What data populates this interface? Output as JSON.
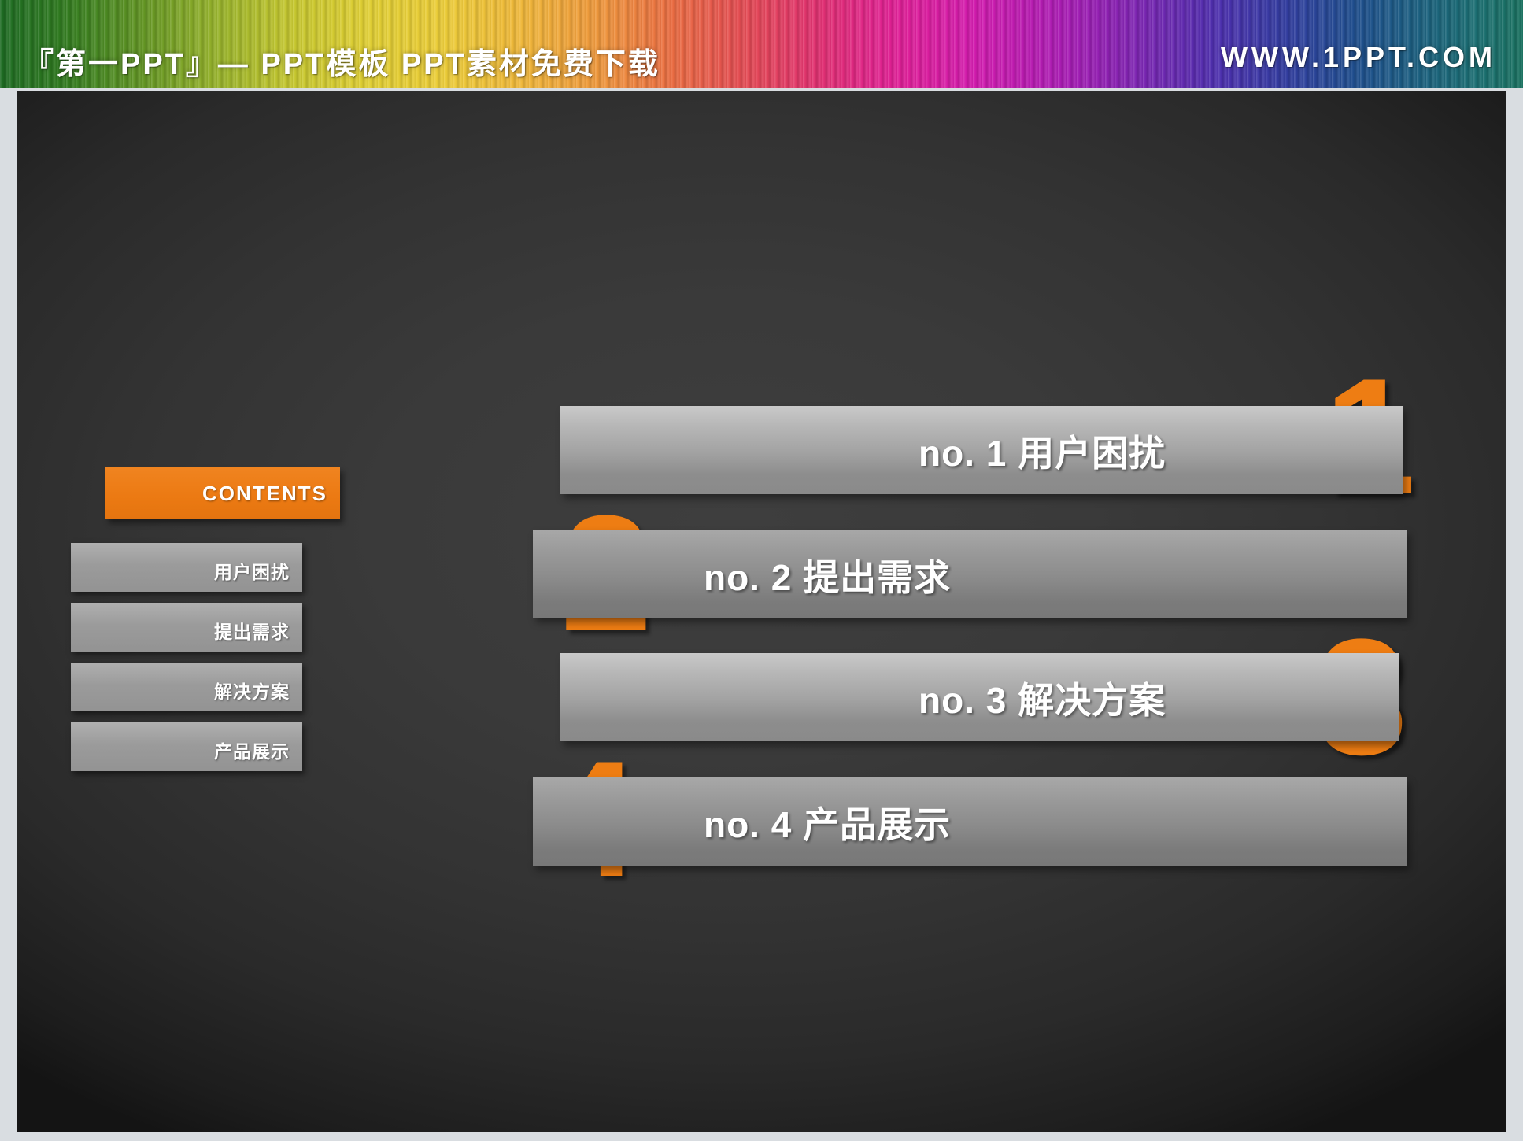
{
  "banner": {
    "title": "『第一PPT』— PPT模板 PPT素材免费下载",
    "url": "WWW.1PPT.COM"
  },
  "sidebar": {
    "contents_label": "CONTENTS",
    "items": [
      {
        "label": "用户困扰"
      },
      {
        "label": "提出需求"
      },
      {
        "label": "解决方案"
      },
      {
        "label": "产品展示"
      }
    ]
  },
  "main": {
    "rows": [
      {
        "number": "1",
        "text": "no. 1  用户困扰"
      },
      {
        "number": "2",
        "text": "no. 2  提出需求"
      },
      {
        "number": "3",
        "text": "no. 3  解决方案"
      },
      {
        "number": "4",
        "text": "no. 4  产品展示"
      }
    ]
  },
  "colors": {
    "accent": "#ee7d13",
    "background": "#333333",
    "bar_light": "#b7b7b7",
    "bar_dark": "#8b8b8b",
    "text": "#ffffff"
  }
}
